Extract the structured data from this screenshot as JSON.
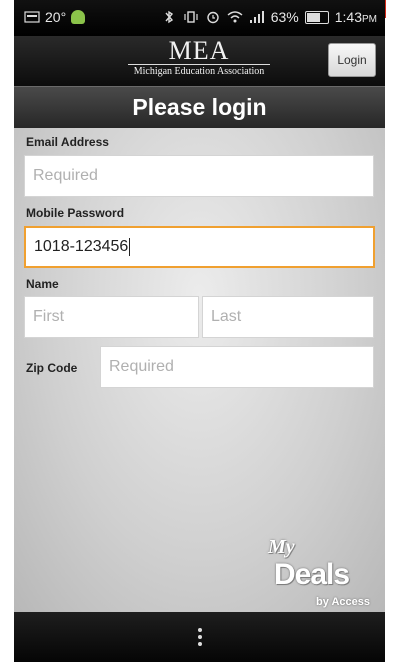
{
  "status_bar": {
    "temperature": "20°",
    "battery_percent": "63%",
    "time": "1:43",
    "ampm": "PM"
  },
  "header": {
    "logo_main": "MEA",
    "logo_sub": "Michigan Education Association",
    "login_label": "Login"
  },
  "title": "Please login",
  "form": {
    "email_label": "Email Address",
    "email_placeholder": "Required",
    "password_label": "Mobile Password",
    "password_value": "1018-123456",
    "name_label": "Name",
    "first_placeholder": "First",
    "last_placeholder": "Last",
    "zip_label": "Zip Code",
    "zip_placeholder": "Required"
  },
  "brand": {
    "my": "My",
    "deals": "Deals",
    "by": "by Access"
  },
  "colors": {
    "accent_focus": "#f0a030",
    "header_bg": "#111111"
  }
}
